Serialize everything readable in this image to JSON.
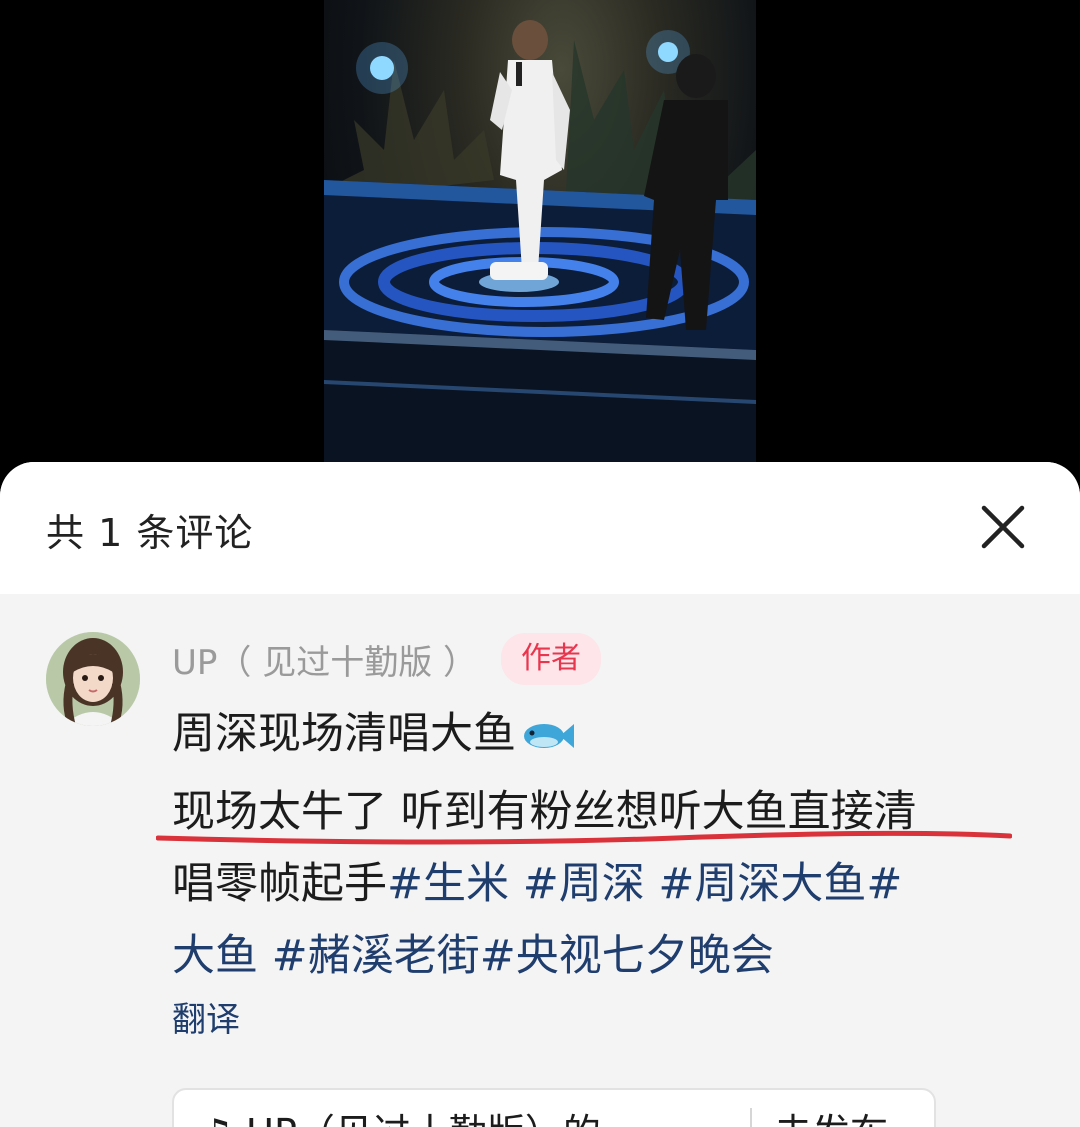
{
  "sheet": {
    "title": "共 1 条评论"
  },
  "comment": {
    "author": "UP（ 见过十勤版 ）",
    "badge": "作者",
    "line1": "周深现场清唱大鱼",
    "line2": "现场太牛了 听到有粉丝想听大鱼直接清",
    "line3_prefix": "唱零帧起手",
    "tags": [
      "#生米",
      "#周深",
      "#周深大鱼#",
      "大鱼",
      "#赭溪老街",
      "#央视七夕晚会"
    ],
    "translate_label": "翻译"
  },
  "footer": {
    "left_text": "UP（见过十勤版）的...",
    "right_text": "去发布"
  },
  "icons": {
    "close": "close-icon",
    "fish": "fish-emoji-icon",
    "music": "music-note-icon"
  },
  "colors": {
    "badge_text": "#e8364f",
    "badge_bg": "#fde5e9",
    "tag": "#1f3e6e",
    "underline": "#d9323a"
  }
}
